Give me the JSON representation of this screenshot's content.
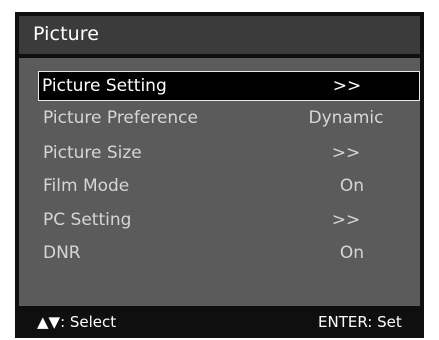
{
  "menu": {
    "title": "Picture",
    "items": [
      {
        "label": "Picture Setting",
        "value": ">>",
        "selected": true
      },
      {
        "label": "Picture Preference",
        "value": "Dynamic",
        "selected": false
      },
      {
        "label": "Picture Size",
        "value": ">>",
        "selected": false
      },
      {
        "label": "Film Mode",
        "value": "On",
        "selected": false
      },
      {
        "label": "PC Setting",
        "value": ">>",
        "selected": false
      },
      {
        "label": "DNR",
        "value": "On",
        "selected": false
      }
    ]
  },
  "footer": {
    "select_hint": "▲▼: Select",
    "enter_hint": "ENTER: Set"
  },
  "colors": {
    "frame": "#0f0f0f",
    "header": "#3b3b3b",
    "body": "#5b5b5b",
    "text": "#ffffff",
    "text_dim": "#d6d6d6"
  }
}
